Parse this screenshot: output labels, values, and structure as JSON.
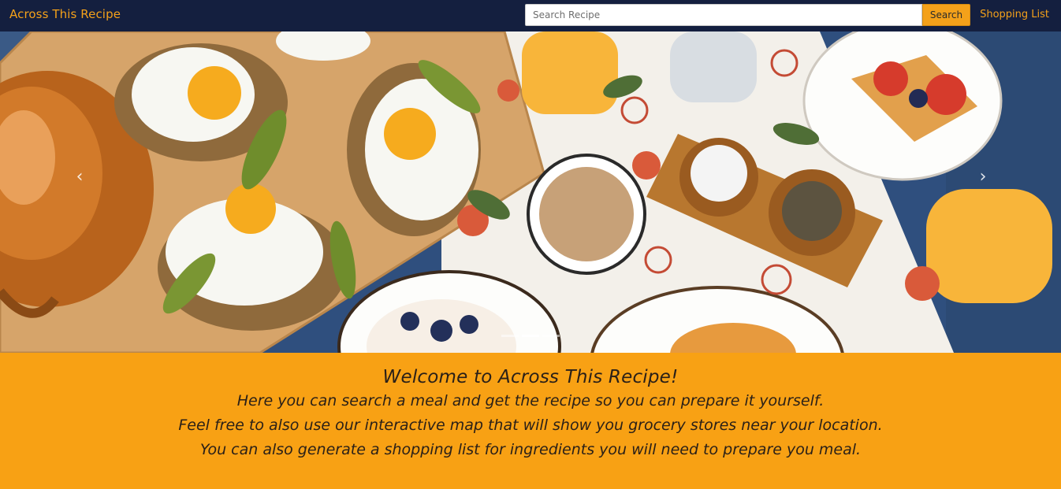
{
  "navbar": {
    "brand": "Across This Recipe",
    "search_placeholder": "Search Recipe",
    "search_button": "Search",
    "shopping_list": "Shopping List"
  },
  "carousel": {
    "prev_icon": "chevron-left-icon",
    "next_icon": "chevron-right-icon",
    "prev_glyph": "‹",
    "next_glyph": "›",
    "slide_count": 3,
    "active_slide": 1
  },
  "welcome": {
    "title": "Welcome to Across This Recipe!",
    "line1": "Here you can search a meal and get the recipe so you can prepare it yourself.",
    "line2": "Feel free to also use our interactive map that will show you grocery stores near your location.",
    "line3": "You can also generate a shopping list for ingredients you will need to prepare you meal."
  },
  "colors": {
    "navbar_bg": "#141f3f",
    "accent": "#f4a11a",
    "banner_bg": "#f8a114"
  }
}
